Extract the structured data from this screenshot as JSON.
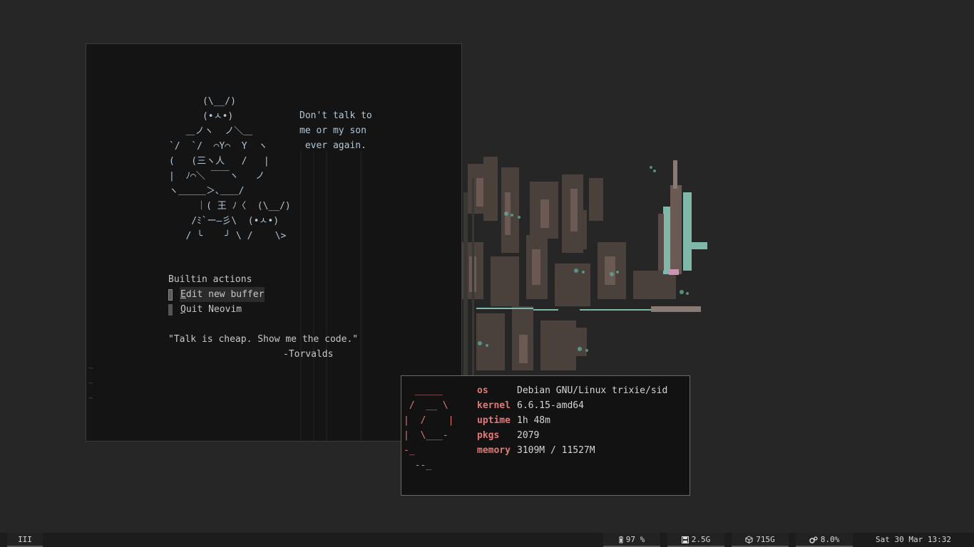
{
  "nvim": {
    "ascii_art": "      (\\__/)\n      (•ㅅ•)\n   ＿ノヽ  ノ＼＿\n`/  `/  ⌒Y⌒  Y  ヽ\n(   (三ヽ人   /   |\n|  ﾉ⌒＼ ￣￣ヽ   ノ\nヽ＿＿＿＞､＿＿/\n     ｜( 王 ﾉ〈  (\\__/)\n    /ﾐ`ー―彡\\  (•ㅅ•)\n   / ╰    ╯ \\ /    \\>",
    "bubble_text": "Don't talk to\nme or my son\n ever again.",
    "actions_header": "Builtin actions",
    "actions": [
      {
        "hotkey": "E",
        "rest": "dit new buffer"
      },
      {
        "hotkey": "Q",
        "rest": "uit Neovim"
      }
    ],
    "quote": "\"Talk is cheap. Show me the code.\"",
    "author": "-Torvalds",
    "tildes": [
      "~",
      "~",
      "~"
    ]
  },
  "neofetch": {
    "logo": "  _____\n /  __ \\\n|  /    |\n|  \\___-\n-_\n  --_",
    "info": [
      {
        "key": "os",
        "value": "Debian GNU/Linux trixie/sid"
      },
      {
        "key": "kernel",
        "value": "6.6.15-amd64"
      },
      {
        "key": "uptime",
        "value": "1h 48m"
      },
      {
        "key": "pkgs",
        "value": "2079"
      },
      {
        "key": "memory",
        "value": "3109M / 11527M"
      }
    ]
  },
  "statusbar": {
    "workspace": "III",
    "battery": "97 %",
    "memory": "2.5G",
    "disk": "715G",
    "cpu": "8.0%",
    "clock": "Sat 30 Mar 13:32",
    "icons": [
      "battery-icon",
      "floppy-icon",
      "cube-icon",
      "gears-icon"
    ]
  },
  "colors": {
    "accent_red": "#e07a78",
    "ascii_blue": "#b2c6d6",
    "city_teal": "#7fb8a8"
  }
}
